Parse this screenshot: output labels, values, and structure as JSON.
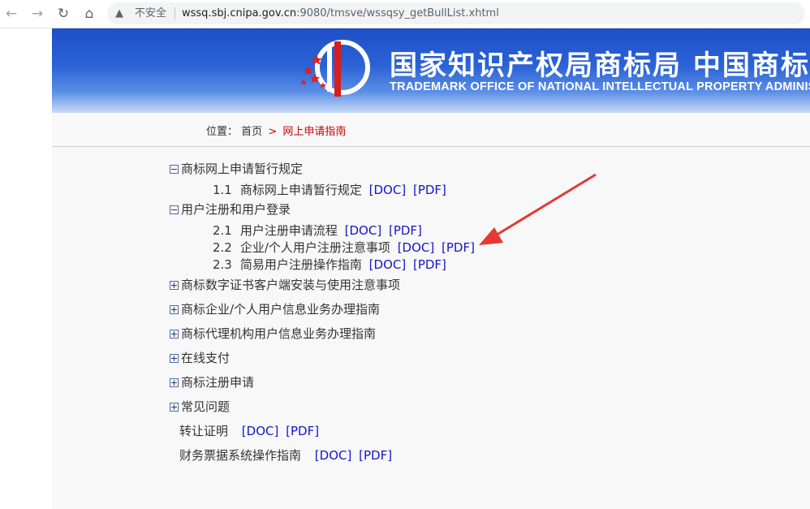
{
  "browser": {
    "back_icon": "back-arrow-icon",
    "forward_icon": "forward-arrow-icon",
    "reload_icon": "reload-icon",
    "home_icon": "home-icon",
    "security_label": "不安全",
    "url_host": "wssq.sbj.cnipa.gov.cn",
    "url_rest": ":9080/tmsve/wssqsy_getBullList.xhtml"
  },
  "banner": {
    "title": "国家知识产权局商标局 中国商标",
    "subtitle": "TRADEMARK OFFICE OF NATIONAL INTELLECTUAL PROPERTY ADMINISTRATION"
  },
  "breadcrumb": {
    "label": "位置：",
    "home": "首页",
    "separator": ">",
    "current": "网上申请指南"
  },
  "tree": {
    "section1": {
      "title": "商标网上申请暂行规定",
      "items": [
        {
          "num": "1.1",
          "label": "商标网上申请暂行规定",
          "doc": "[DOC]",
          "pdf": "[PDF]"
        }
      ]
    },
    "section2": {
      "title": "用户注册和用户登录",
      "items": [
        {
          "num": "2.1",
          "label": "用户注册申请流程",
          "doc": "[DOC]",
          "pdf": "[PDF]"
        },
        {
          "num": "2.2",
          "label": "企业/个人用户注册注意事项",
          "doc": "[DOC]",
          "pdf": "[PDF]"
        },
        {
          "num": "2.3",
          "label": "简易用户注册操作指南",
          "doc": "[DOC]",
          "pdf": "[PDF]"
        }
      ]
    },
    "collapsed": [
      "商标数字证书客户端安装与使用注意事项",
      "商标企业/个人用户信息业务办理指南",
      "商标代理机构用户信息业务办理指南",
      "在线支付",
      "商标注册申请",
      "常见问题"
    ],
    "plain": [
      {
        "label": "转让证明",
        "doc": "[DOC]",
        "pdf": "[PDF]"
      },
      {
        "label": "财务票据系统操作指南",
        "doc": "[DOC]",
        "pdf": "[PDF]"
      }
    ]
  },
  "colors": {
    "link": "#1515c8",
    "breadcrumb_current": "#cc0000",
    "annotation_arrow": "#e53935"
  }
}
